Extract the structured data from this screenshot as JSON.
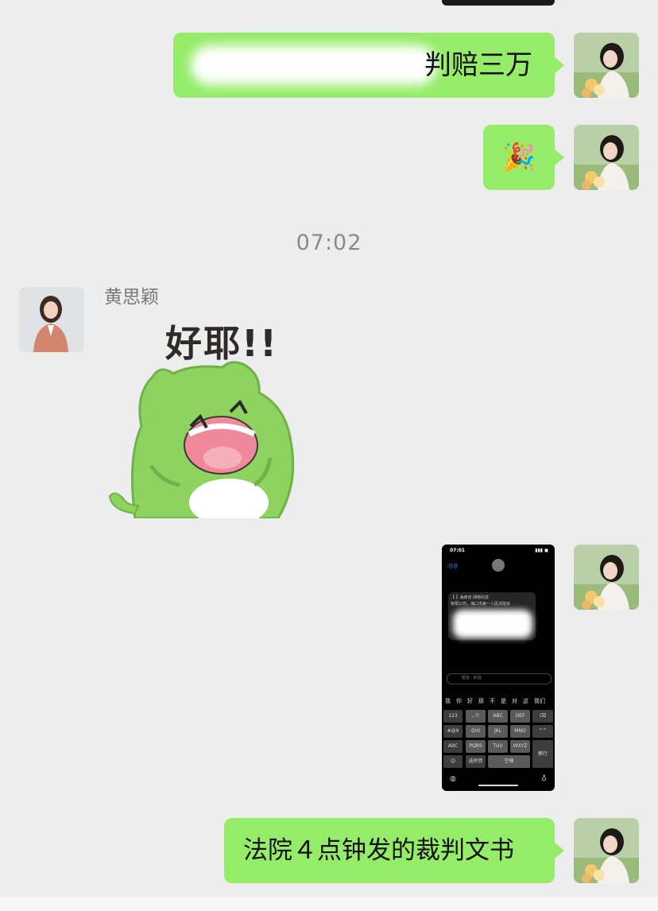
{
  "messages": {
    "msg1_text": "判赔三万",
    "msg2_emoji": "🎉",
    "timestamp": "07:02",
    "sender_name": "黄思颖",
    "sticker_text": "好耶!!",
    "msg_last_text": "法院４点钟发的裁判文书"
  },
  "phone_screenshot": {
    "status_time": "07:01",
    "back_label": "信息",
    "sms_line1": "【 】海南省 网络科技",
    "sms_line2": "有限公司，海口市第一人民法院诉",
    "input_placeholder": "短信 · 彩信",
    "candidates": [
      "我",
      "你",
      "好",
      "那",
      "不",
      "是",
      "对",
      "这",
      "我们"
    ],
    "keys_row1": [
      "123",
      ",.?!",
      "ABC",
      "DEF",
      "⌫"
    ],
    "keys_row2": [
      "#@¥",
      "GHI",
      "JKL",
      "MNO",
      "^^"
    ],
    "keys_row3": [
      "ABC",
      "PQRS",
      "TUV",
      "WXYZ",
      "换行"
    ],
    "keys_row4": [
      "☺",
      "选拼音",
      "空格"
    ]
  },
  "colors": {
    "bubble_green": "#95ec69",
    "background": "#ededed"
  }
}
